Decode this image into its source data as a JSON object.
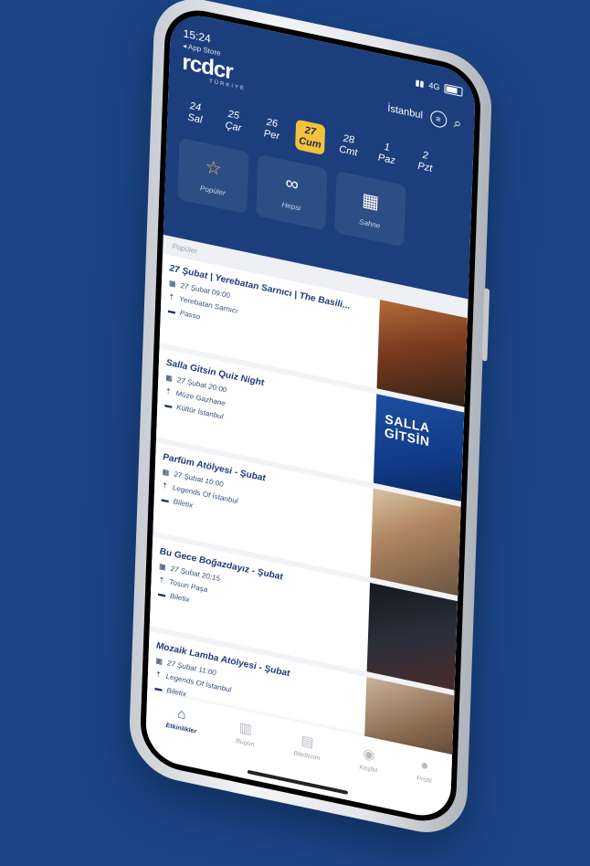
{
  "status": {
    "time": "15:24",
    "back_label": "◂ App Store",
    "network": "4G"
  },
  "brand": {
    "logo": "rcdcr",
    "sub": "TÜRKIYE"
  },
  "header": {
    "city": "İstanbul"
  },
  "dates": [
    {
      "day": "24",
      "weekday": "Sal"
    },
    {
      "day": "25",
      "weekday": "Çar"
    },
    {
      "day": "26",
      "weekday": "Per"
    },
    {
      "day": "27",
      "weekday": "Cum"
    },
    {
      "day": "28",
      "weekday": "Cmt"
    },
    {
      "day": "1",
      "weekday": "Paz"
    },
    {
      "day": "2",
      "weekday": "Pzt"
    }
  ],
  "categories": [
    {
      "label": "Popüler",
      "icon": "☆"
    },
    {
      "label": "Hepsi",
      "icon": "∞"
    },
    {
      "label": "Sahne",
      "icon": "▦"
    }
  ],
  "section_title": "Popüler",
  "events": [
    {
      "title": "27 Şubat | Yerebatan Sarnıcı | The Basili...",
      "date": "27 Şubat 09:00",
      "venue": "Yerebatan Sarnıcı",
      "vendor": "Passo"
    },
    {
      "title": "Salla Gitsin Quiz Night",
      "date": "27 Şubat 20:00",
      "venue": "Müze Gazhane",
      "vendor": "Kültür İstanbul"
    },
    {
      "title": "Parfüm Atölyesi - Şubat",
      "date": "27 Şubat 10:00",
      "venue": "Legends Of İstanbul",
      "vendor": "Biletix"
    },
    {
      "title": "Bu Gece Boğazdayız - Şubat",
      "date": "27 Şubat 20:15",
      "venue": "Tosun Paşa",
      "vendor": "Biletix"
    },
    {
      "title": "Mozaik Lamba Atölyesi - Şubat",
      "date": "27 Şubat 11:00",
      "venue": "Legends Of İstanbul",
      "vendor": "Biletix"
    }
  ],
  "thumb_text": {
    "salla": "SALLA GİTSİN"
  },
  "tabs": [
    {
      "label": "Etkinlikler",
      "icon": "⌂"
    },
    {
      "label": "Bugün",
      "icon": "▥"
    },
    {
      "label": "Biletlerim",
      "icon": "▤"
    },
    {
      "label": "Keşfet",
      "icon": "◉"
    },
    {
      "label": "Profil",
      "icon": "●"
    }
  ],
  "colors": {
    "accent": "#f3c23c",
    "primary": "#1c3e7d",
    "background": "#1b4589"
  }
}
